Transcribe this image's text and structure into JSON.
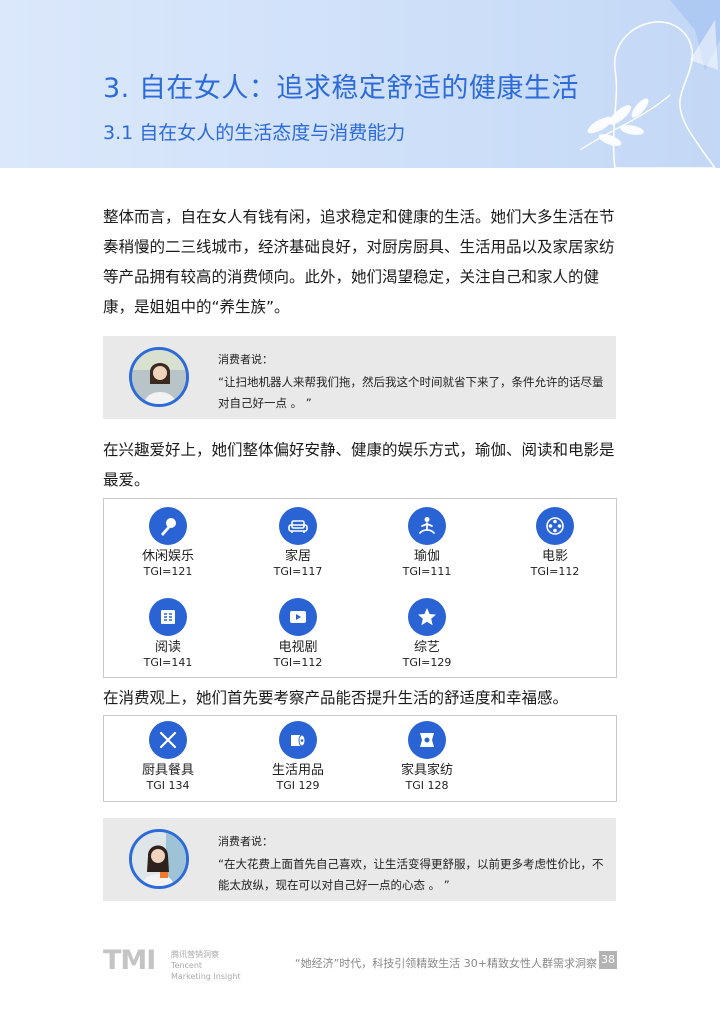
{
  "header": {
    "title": "3. 自在女人：追求稳定舒适的健康生活",
    "subtitle": "3.1 自在女人的生活态度与消费能力"
  },
  "paragraphs": {
    "intro": "整体而言，自在女人有钱有闲，追求稳定和健康的生活。她们大多生活在节奏稍慢的二三线城市，经济基础良好，对厨房厨具、生活用品以及家居家纺等产品拥有较高的消费倾向。此外，她们渴望稳定，关注自己和家人的健康，是姐姐中的“养生族”。",
    "interests": "在兴趣爱好上，她们整体偏好安静、健康的娱乐方式，瑜伽、阅读和电影是最爱。",
    "consumption": "在消费观上，她们首先要考察产品能否提升生活的舒适度和幸福感。"
  },
  "quotes": [
    {
      "label": "消费者说：",
      "text": "“让扫地机器人来帮我们拖，然后我这个时间就省下来了，条件允许的话尽量对自己好一点 。 ”"
    },
    {
      "label": "消费者说：",
      "text": "“在大花费上面首先自己喜欢，让生活变得更舒服，以前更多考虑性价比，不能太放纵，现在可以对自己好一点的心态 。 ”"
    }
  ],
  "interests": [
    {
      "icon": "microphone-icon",
      "label": "休闲娱乐",
      "tgi": "TGI=121"
    },
    {
      "icon": "sofa-icon",
      "label": "家居",
      "tgi": "TGI=117"
    },
    {
      "icon": "yoga-icon",
      "label": "瑜伽",
      "tgi": "TGI=111"
    },
    {
      "icon": "film-reel-icon",
      "label": "电影",
      "tgi": "TGI=112"
    },
    {
      "icon": "book-icon",
      "label": "阅读",
      "tgi": "TGI=141"
    },
    {
      "icon": "video-icon",
      "label": "电视剧",
      "tgi": "TGI=112"
    },
    {
      "icon": "star-icon",
      "label": "综艺",
      "tgi": "TGI=129"
    }
  ],
  "categories": [
    {
      "icon": "fork-knife-icon",
      "label": "厨具餐具",
      "tgi": "TGI 134"
    },
    {
      "icon": "tissue-roll-icon",
      "label": "生活用品",
      "tgi": "TGI 129"
    },
    {
      "icon": "home-textile-icon",
      "label": "家具家纺",
      "tgi": "TGI 128"
    }
  ],
  "footer": {
    "logo": "TMI",
    "logo_cn": "腾讯营销洞察",
    "logo_en1": "Tencent",
    "logo_en2": "Marketing Insight",
    "report_title": "“她经济”时代，科技引领精致生活 30+精致女性人群需求洞察",
    "page": "38"
  },
  "colors": {
    "accent": "#2c6bd8",
    "icon_bg": "#2a63d4",
    "quote_bg": "#e9e9e9"
  }
}
